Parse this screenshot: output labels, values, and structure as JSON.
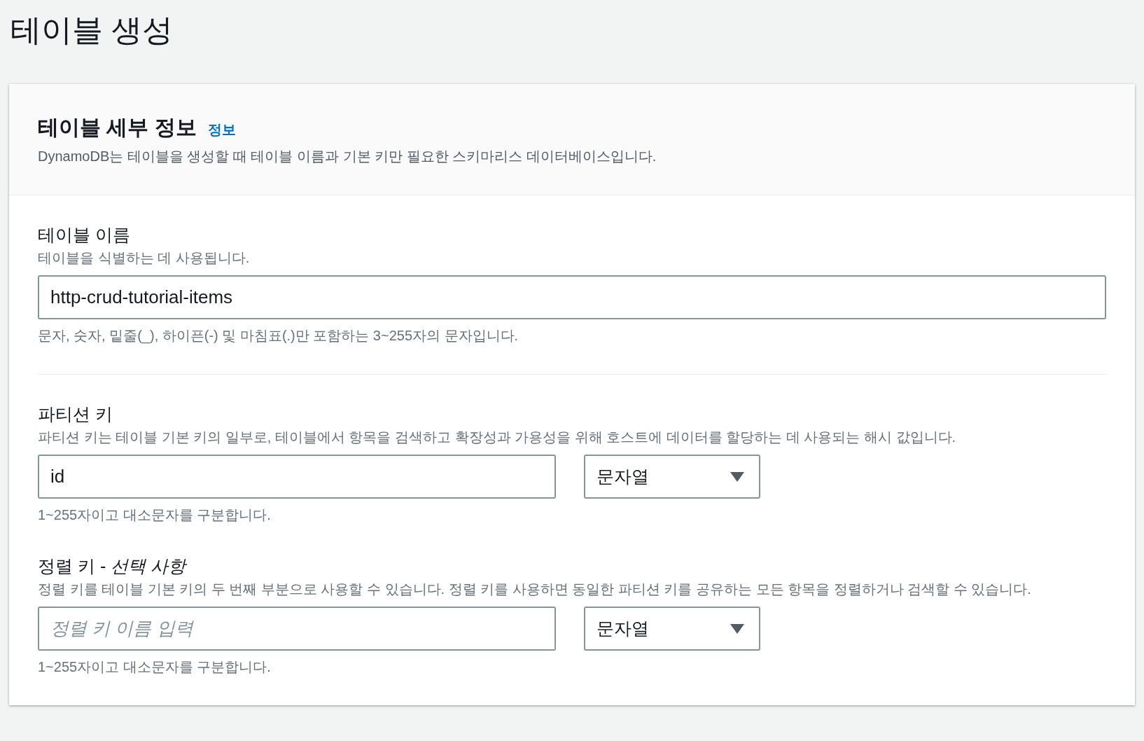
{
  "page_title": "테이블 생성",
  "panel": {
    "title": "테이블 세부 정보",
    "info_link": "정보",
    "description": "DynamoDB는 테이블을 생성할 때 테이블 이름과 기본 키만 필요한 스키마리스 데이터베이스입니다."
  },
  "table_name": {
    "label": "테이블 이름",
    "description": "테이블을 식별하는 데 사용됩니다.",
    "value": "http-crud-tutorial-items",
    "constraint": "문자, 숫자, 밑줄(_), 하이픈(-) 및 마침표(.)만 포함하는 3~255자의 문자입니다."
  },
  "partition_key": {
    "label": "파티션 키",
    "description": "파티션 키는 테이블 기본 키의 일부로, 테이블에서 항목을 검색하고 확장성과 가용성을 위해 호스트에 데이터를 할당하는 데 사용되는 해시 값입니다.",
    "value": "id",
    "type": "문자열",
    "constraint": "1~255자이고 대소문자를 구분합니다."
  },
  "sort_key": {
    "label": "정렬 키 - *선택 사항*",
    "description": "정렬 키를 테이블 기본 키의 두 번째 부분으로 사용할 수 있습니다. 정렬 키를 사용하면 동일한 파티션 키를 공유하는 모든 항목을 정렬하거나 검색할 수 있습니다.",
    "placeholder": "정렬 키 이름 입력",
    "type": "문자열",
    "constraint": "1~255자이고 대소문자를 구분합니다."
  }
}
